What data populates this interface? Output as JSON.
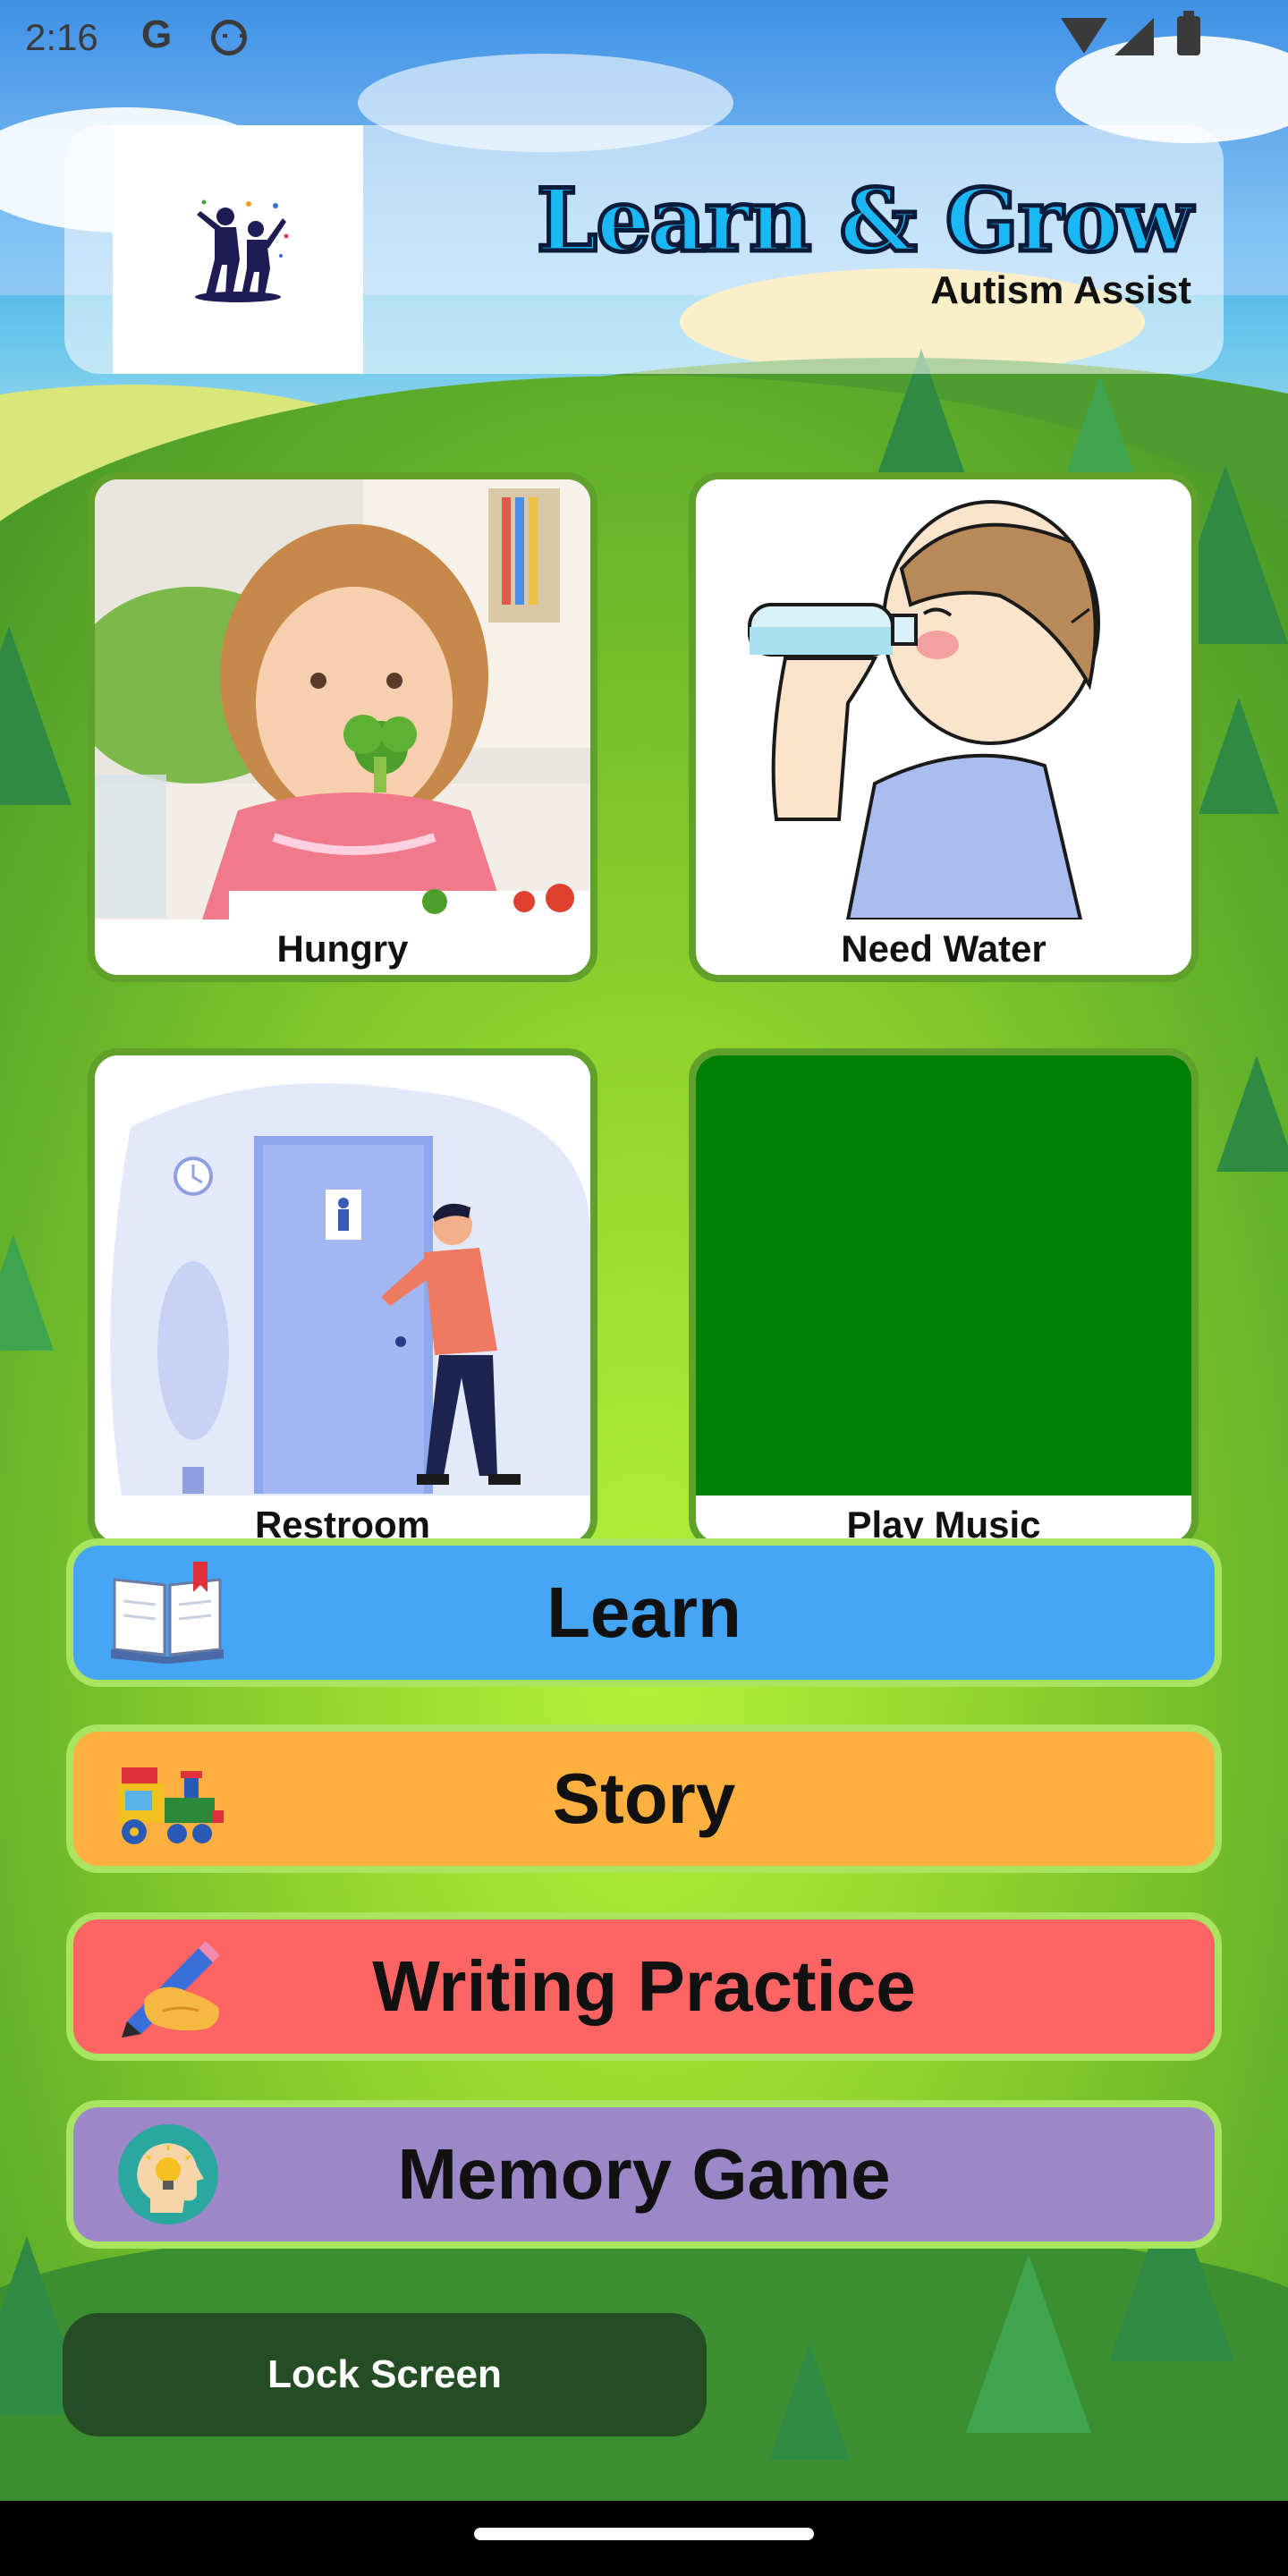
{
  "status_bar": {
    "time": "2:16",
    "notification_icons": [
      "google-g-icon",
      "face-icon"
    ],
    "system_icons": [
      "wifi-icon",
      "signal-icon",
      "battery-icon"
    ]
  },
  "header": {
    "title": "Learn & Grow",
    "subtitle": "Autism Assist",
    "logo": "kids-stars-logo"
  },
  "cards": [
    {
      "label": "Hungry",
      "image": "girl-eating-broccoli"
    },
    {
      "label": "Need Water",
      "image": "boy-drinking-water"
    },
    {
      "label": "Restroom",
      "image": "man-at-restroom-door"
    },
    {
      "label": "Play Music",
      "image": "solid-green-placeholder"
    }
  ],
  "menu": {
    "learn": {
      "label": "Learn",
      "icon": "open-book-icon",
      "color": "#46a6f6"
    },
    "story": {
      "label": "Story",
      "icon": "toy-train-icon",
      "color": "#fdb03d"
    },
    "writing": {
      "label": "Writing Practice",
      "icon": "pencil-hand-icon",
      "color": "#fd6464"
    },
    "memory": {
      "label": "Memory Game",
      "icon": "brain-lightbulb-icon",
      "color": "#9c88c8"
    }
  },
  "lock_button": {
    "label": "Lock Screen"
  }
}
